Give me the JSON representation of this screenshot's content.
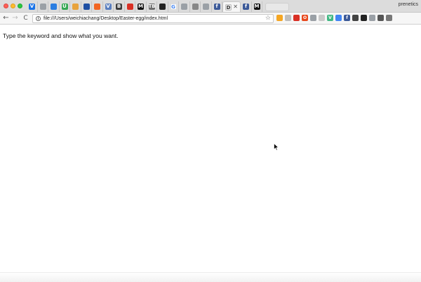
{
  "browser": {
    "tabs": [
      {
        "favicon": "v-icon",
        "color": "#1a73e8",
        "glyph": "V"
      },
      {
        "favicon": "doc-icon",
        "color": "#9aa0a6",
        "glyph": ""
      },
      {
        "favicon": "sheet-icon",
        "color": "#2a7de1",
        "glyph": ""
      },
      {
        "favicon": "u-icon",
        "color": "#34a853",
        "glyph": "U"
      },
      {
        "favicon": "stack-icon",
        "color": "#e8a33d",
        "glyph": ""
      },
      {
        "favicon": "circle-icon",
        "color": "#1e4fa3",
        "glyph": ""
      },
      {
        "favicon": "orange-circle-icon",
        "color": "#f26522",
        "glyph": ""
      },
      {
        "favicon": "v-icon",
        "color": "#5b7fbf",
        "glyph": "V"
      },
      {
        "favicon": "b-icon",
        "color": "#3c3c3c",
        "glyph": "B"
      },
      {
        "favicon": "pin-icon",
        "color": "#d93025",
        "glyph": ""
      },
      {
        "favicon": "medium-icon",
        "color": "#111111",
        "glyph": "M"
      },
      {
        "favicon": "tb-icon",
        "color": "#6d6d6d",
        "glyph": "TB"
      },
      {
        "favicon": "github-icon",
        "color": "#222222",
        "glyph": ""
      },
      {
        "favicon": "google-icon",
        "color": "#ffffff",
        "glyph": "G"
      },
      {
        "favicon": "doc-icon",
        "color": "#9aa0a6",
        "glyph": ""
      },
      {
        "favicon": "puzzle-icon",
        "color": "#888888",
        "glyph": ""
      },
      {
        "favicon": "doc-icon",
        "color": "#9aa0a6",
        "glyph": ""
      },
      {
        "favicon": "facebook-icon",
        "color": "#3b5998",
        "glyph": "f"
      },
      {
        "favicon": "facebook-icon",
        "color": "#3b5998",
        "glyph": "f"
      },
      {
        "favicon": "medium-icon",
        "color": "#111111",
        "glyph": "M"
      }
    ],
    "active_tab": {
      "title": "D",
      "close": "✕"
    },
    "profile_name": "prenetics",
    "navigation": {
      "back": "←",
      "forward": "→",
      "reload": "C"
    },
    "address": "file:///Users/weichiachang/Desktop/Easter-egg/index.html",
    "extensions": [
      {
        "name": "ext-orange-icon",
        "color": "#f5a623",
        "glyph": ""
      },
      {
        "name": "ext-code-icon",
        "color": "#bdbdbd",
        "glyph": ""
      },
      {
        "name": "ext-red-icon",
        "color": "#d93025",
        "glyph": ""
      },
      {
        "name": "ext-opera-icon",
        "color": "#e8491d",
        "glyph": "O"
      },
      {
        "name": "ext-grey-icon",
        "color": "#9aa0a6",
        "glyph": ""
      },
      {
        "name": "ext-lines-icon",
        "color": "#c9c9c9",
        "glyph": ""
      },
      {
        "name": "ext-vue-icon",
        "color": "#41b883",
        "glyph": "V"
      },
      {
        "name": "ext-blue-icon",
        "color": "#4285f4",
        "glyph": ""
      },
      {
        "name": "ext-facebook-icon",
        "color": "#3b5998",
        "glyph": "f"
      },
      {
        "name": "ext-eye-icon",
        "color": "#444444",
        "glyph": ""
      },
      {
        "name": "ext-dark-icon",
        "color": "#222222",
        "glyph": ""
      },
      {
        "name": "ext-filter-icon",
        "color": "#9aa0a6",
        "glyph": ""
      },
      {
        "name": "ext-mic-icon",
        "color": "#555555",
        "glyph": ""
      },
      {
        "name": "ext-menu-icon",
        "color": "#777777",
        "glyph": ""
      }
    ]
  },
  "page": {
    "message": "Type the keyword and show what you want."
  }
}
